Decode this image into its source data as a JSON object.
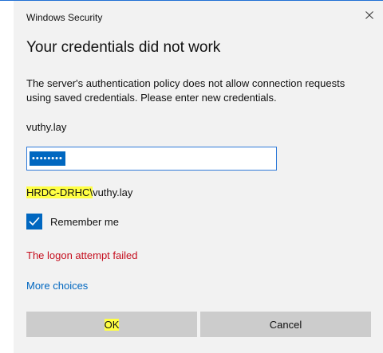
{
  "window": {
    "title": "Windows Security",
    "close_icon": "close-icon"
  },
  "heading": "Your credentials did not work",
  "message": "The server's authentication policy does not allow connection requests using saved credentials. Please enter new credentials.",
  "username": "vuthy.lay",
  "password": {
    "masked_value": "••••••••"
  },
  "domain_user": {
    "domain": "HRDC-DRHC",
    "separator": "\\",
    "user": "vuthy.lay"
  },
  "remember": {
    "label": "Remember me",
    "checked": true
  },
  "error": "The logon attempt failed",
  "more_choices": "More choices",
  "buttons": {
    "ok": "OK",
    "cancel": "Cancel"
  },
  "colors": {
    "accent": "#0067c0",
    "error": "#c50f1f",
    "highlight": "#ffff44",
    "dialog_bg": "#f2f2f2",
    "button_bg": "#cccccc"
  }
}
